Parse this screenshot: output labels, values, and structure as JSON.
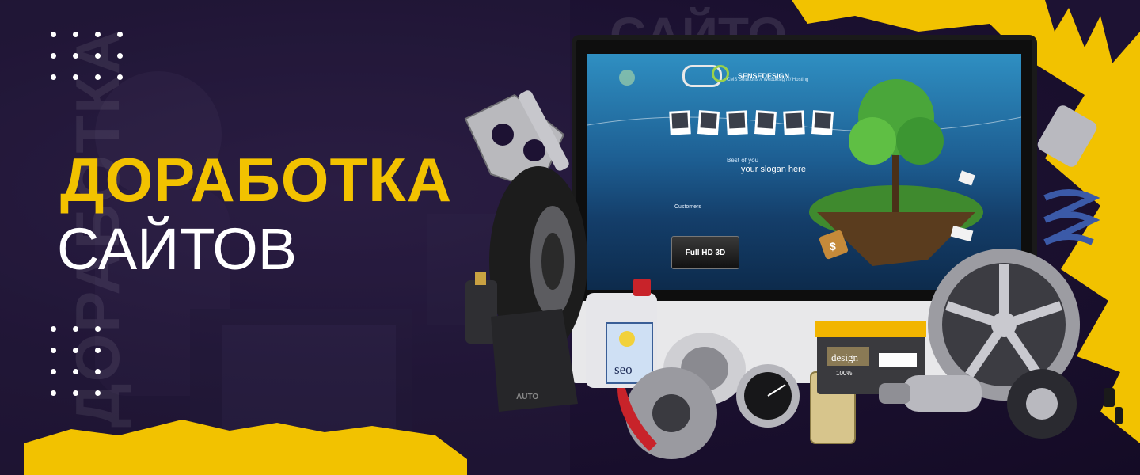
{
  "banner": {
    "title": "ДОРАБОТКА",
    "subtitle": "САЙТОВ",
    "ghost_vertical": "ДОРАБОТКА",
    "ghost_top": "САЙТО",
    "accent_color": "#f2c200",
    "background_color": "#1d1233"
  },
  "screen": {
    "brand": "SENSEDESIGN",
    "tagline": "CMS Solutions // Webdesign // Hosting",
    "slogan_top": "Best of you",
    "slogan_main": "your slogan here",
    "customers_label": "Customers",
    "badge_text": "Full HD 3D"
  },
  "products": {
    "canister_label": "seo",
    "battery_label": "design",
    "battery_small": "100%",
    "mudflap_label": "AUTO"
  }
}
